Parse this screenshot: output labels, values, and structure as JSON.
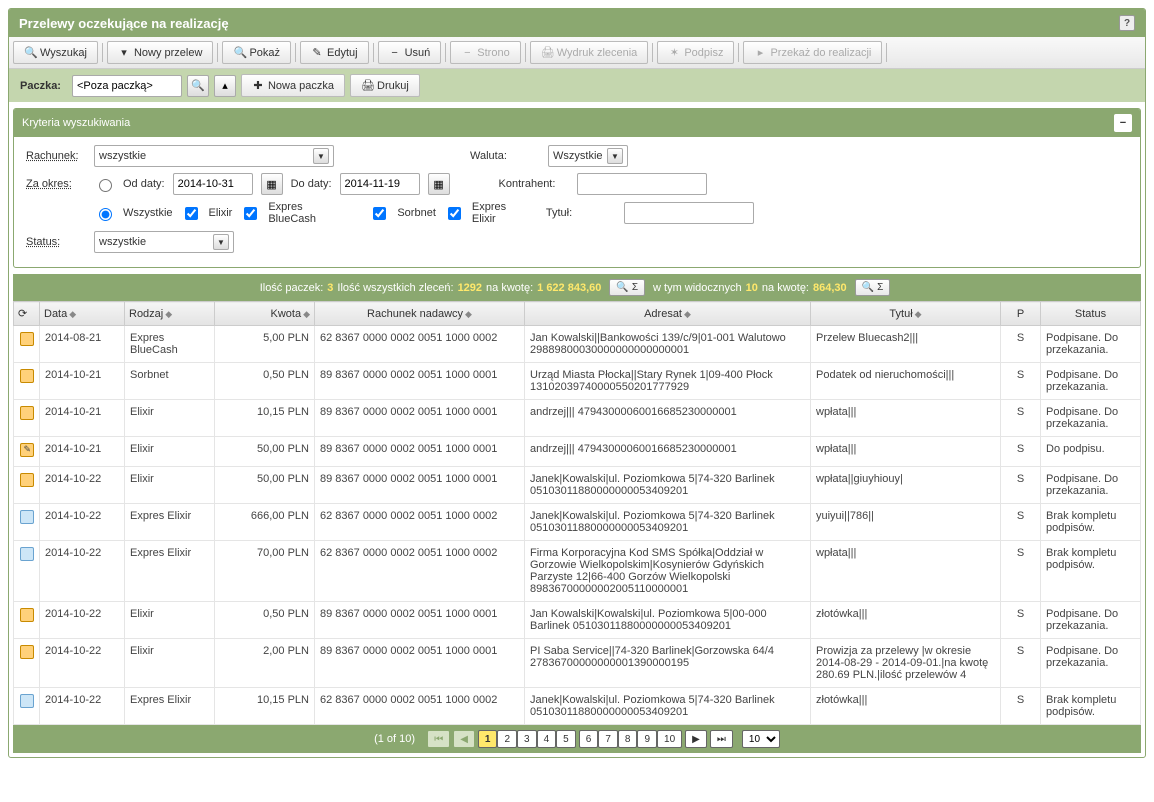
{
  "title": "Przelewy oczekujące na realizację",
  "toolbar": [
    {
      "id": "search",
      "label": "Wyszukaj",
      "icon": "🔍"
    },
    {
      "id": "new",
      "label": "Nowy przelew",
      "icon": "▾"
    },
    {
      "id": "show",
      "label": "Pokaż",
      "icon": "🔍"
    },
    {
      "id": "edit",
      "label": "Edytuj",
      "icon": "✎"
    },
    {
      "id": "delete",
      "label": "Usuń",
      "icon": "−"
    },
    {
      "id": "strono",
      "label": "Strono",
      "icon": "−",
      "disabled": true
    },
    {
      "id": "print-order",
      "label": "Wydruk zlecenia",
      "icon": "🖨",
      "disabled": true
    },
    {
      "id": "sign",
      "label": "Podpisz",
      "icon": "✶",
      "disabled": true
    },
    {
      "id": "execute",
      "label": "Przekaż do realizacji",
      "icon": "▸",
      "disabled": true
    }
  ],
  "paczka": {
    "label": "Paczka:",
    "value": "<Poza paczką>",
    "newLabel": "Nowa paczka",
    "printLabel": "Drukuj"
  },
  "criteria": {
    "title": "Kryteria wyszukiwania",
    "rachunekLabel": "Rachunek:",
    "rachunekVal": "wszystkie",
    "walutaLabel": "Waluta:",
    "walutaVal": "Wszystkie",
    "okresLabel": "Za okres:",
    "odLabel": "Od daty:",
    "odVal": "2014-10-31",
    "doLabel": "Do daty:",
    "doVal": "2014-11-19",
    "kontrahentLabel": "Kontrahent:",
    "kontrahentVal": "",
    "wszystkie": "Wszystkie",
    "elixir": "Elixir",
    "expresBlue": "Expres BlueCash",
    "sorbnet": "Sorbnet",
    "expresElixir": "Expres Elixir",
    "tytulLabel": "Tytuł:",
    "tytulVal": "",
    "statusLabel": "Status:",
    "statusVal": "wszystkie"
  },
  "summary": {
    "paczekLabel": "Ilość paczek:",
    "paczek": "3",
    "zlecLabel": "Ilość wszystkich zleceń:",
    "zlec": "1292",
    "kwota1Label": "na kwotę:",
    "kwota1": "1 622 843,60",
    "widLabel": "w tym widocznych",
    "wid": "10",
    "kwota2Label": "na kwotę:",
    "kwota2": "864,30",
    "sigma": "Σ"
  },
  "cols": {
    "data": "Data",
    "rodzaj": "Rodzaj",
    "kwota": "Kwota",
    "rach": "Rachunek nadawcy",
    "adresat": "Adresat",
    "tytul": "Tytuł",
    "p": "P",
    "status": "Status"
  },
  "rows": [
    {
      "ico": "file",
      "data": "2014-08-21",
      "rodzaj": "Expres BlueCash",
      "kwota": "5,00 PLN",
      "rach": "62 8367 0000 0002 0051 1000 0002",
      "adresat": "Jan Kowalski||Bankowości 139/c/9|01-001 Walutowo 29889800030000000000000001",
      "tytul": "Przelew Bluecash2|||",
      "p": "S",
      "status": "Podpisane. Do przekazania.",
      "stcls": "st-red"
    },
    {
      "ico": "file",
      "data": "2014-10-21",
      "rodzaj": "Sorbnet",
      "kwota": "0,50 PLN",
      "rach": "89 8367 0000 0002 0051 1000 0001",
      "adresat": "Urząd Miasta Płocka||Stary Rynek 1|09-400 Płock 13102039740000550201777929",
      "tytul": "Podatek od nieruchomości|||",
      "p": "S",
      "status": "Podpisane. Do przekazania.",
      "stcls": "st-red"
    },
    {
      "ico": "file",
      "data": "2014-10-21",
      "rodzaj": "Elixir",
      "kwota": "10,15 PLN",
      "rach": "89 8367 0000 0002 0051 1000 0001",
      "adresat": "andrzej||| 47943000060016685230000001",
      "tytul": "wpłata|||",
      "p": "S",
      "status": "Podpisane. Do przekazania.",
      "stcls": "st-red"
    },
    {
      "ico": "edit",
      "data": "2014-10-21",
      "rodzaj": "Elixir",
      "kwota": "50,00 PLN",
      "rach": "89 8367 0000 0002 0051 1000 0001",
      "adresat": "andrzej||| 47943000060016685230000001",
      "tytul": "wpłata|||",
      "p": "S",
      "status": "Do podpisu.",
      "stcls": "st-red"
    },
    {
      "ico": "file",
      "data": "2014-10-22",
      "rodzaj": "Elixir",
      "kwota": "50,00 PLN",
      "rach": "89 8367 0000 0002 0051 1000 0001",
      "adresat": "Janek|Kowalski|ul. Poziomkowa 5|74-320 Barlinek 05103011880000000053409201",
      "tytul": "wpłata||giuyhiouy|",
      "p": "S",
      "status": "Podpisane. Do przekazania.",
      "stcls": "st-red"
    },
    {
      "ico": "doc",
      "data": "2014-10-22",
      "rodzaj": "Expres Elixir",
      "kwota": "666,00 PLN",
      "rach": "62 8367 0000 0002 0051 1000 0002",
      "adresat": "Janek|Kowalski|ul. Poziomkowa 5|74-320 Barlinek 05103011880000000053409201",
      "tytul": "yuiyui||786||",
      "p": "S",
      "status": "Brak kompletu podpisów.",
      "stcls": "st-blue"
    },
    {
      "ico": "doc",
      "data": "2014-10-22",
      "rodzaj": "Expres Elixir",
      "kwota": "70,00 PLN",
      "rach": "62 8367 0000 0002 0051 1000 0002",
      "adresat": "Firma Korporacyjna Kod SMS Spółka|Oddział w Gorzowie Wielkopolskim|Kosynierów Gdyńskich Parzyste 12|66-400 Gorzów Wielkopolski 89836700000002005110000001",
      "tytul": "wpłata|||",
      "p": "S",
      "status": "Brak kompletu podpisów.",
      "stcls": "st-blue"
    },
    {
      "ico": "file",
      "data": "2014-10-22",
      "rodzaj": "Elixir",
      "kwota": "0,50 PLN",
      "rach": "89 8367 0000 0002 0051 1000 0001",
      "adresat": "Jan Kowalski|Kowalski|ul. Poziomkowa 5|00-000 Barlinek 05103011880000000053409201",
      "tytul": "złotówka|||",
      "p": "S",
      "status": "Podpisane. Do przekazania.",
      "stcls": "st-red"
    },
    {
      "ico": "file",
      "data": "2014-10-22",
      "rodzaj": "Elixir",
      "kwota": "2,00 PLN",
      "rach": "89 8367 0000 0002 0051 1000 0001",
      "adresat": "PI Saba Service||74-320 Barlinek|Gorzowska 64/4 27836700000000001390000195",
      "tytul": "Prowizja za przelewy |w okresie 2014-08-29 - 2014-09-01.|na kwotę 280.69 PLN.|ilość przelewów 4",
      "p": "S",
      "status": "Podpisane. Do przekazania.",
      "stcls": "st-red"
    },
    {
      "ico": "doc",
      "data": "2014-10-22",
      "rodzaj": "Expres Elixir",
      "kwota": "10,15 PLN",
      "rach": "62 8367 0000 0002 0051 1000 0002",
      "adresat": "Janek|Kowalski|ul. Poziomkowa 5|74-320 Barlinek 05103011880000000053409201",
      "tytul": "złotówka|||",
      "p": "S",
      "status": "Brak kompletu podpisów.",
      "stcls": "st-blue"
    }
  ],
  "pager": {
    "info": "(1 of 10)",
    "pages": [
      "1",
      "2",
      "3",
      "4",
      "5",
      "6",
      "7",
      "8",
      "9",
      "10"
    ],
    "cur": "1",
    "size": "10"
  }
}
